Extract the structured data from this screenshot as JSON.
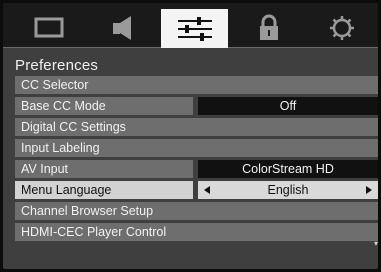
{
  "tabs": [
    {
      "icon": "picture-icon",
      "active": false
    },
    {
      "icon": "audio-icon",
      "active": false
    },
    {
      "icon": "preferences-icon",
      "active": true
    },
    {
      "icon": "lock-icon",
      "active": false
    },
    {
      "icon": "setup-icon",
      "active": false
    }
  ],
  "title": "Preferences",
  "items": [
    {
      "label": "CC Selector"
    },
    {
      "label": "Base CC Mode",
      "value": "Off"
    },
    {
      "label": "Digital CC Settings"
    },
    {
      "label": "Input Labeling"
    },
    {
      "label": "AV Input",
      "value": "ColorStream HD"
    },
    {
      "label": "Menu Language",
      "value": "English",
      "selected": true
    },
    {
      "label": "Channel Browser Setup"
    },
    {
      "label": "HDMI-CEC Player Control"
    }
  ],
  "colors": {
    "background": "#3f3f3f",
    "item": "#6e6e6e",
    "value_box": "#111111",
    "selected": "#d2d2d2",
    "active_tab": "#f4f4f4"
  }
}
